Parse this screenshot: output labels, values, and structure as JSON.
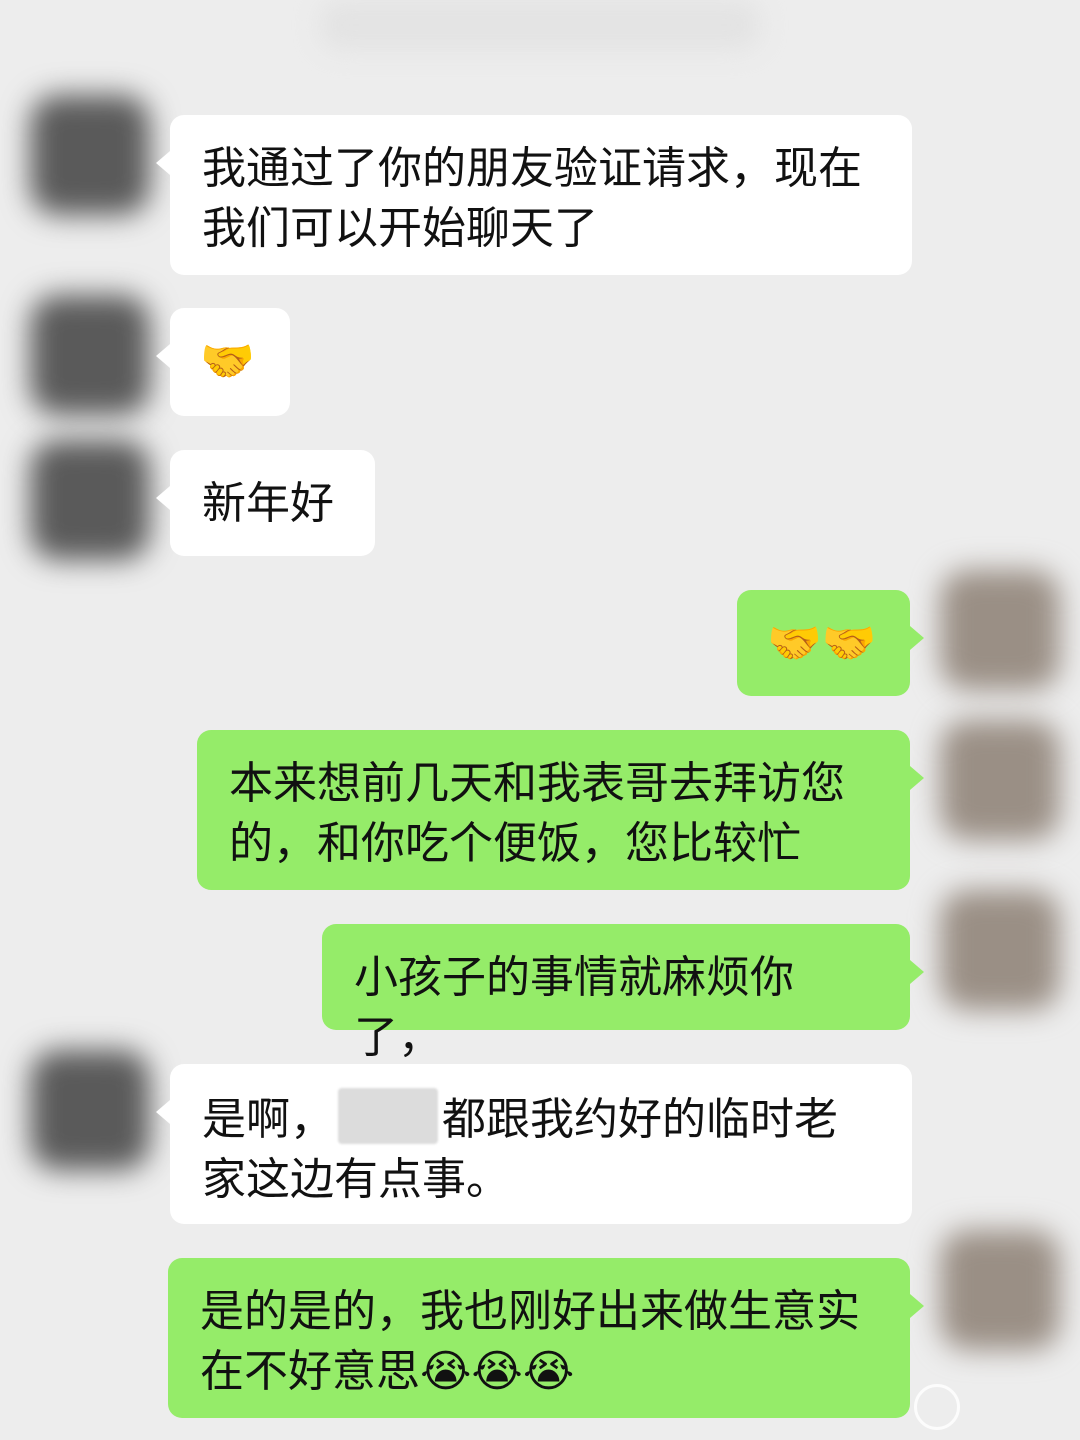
{
  "messages": [
    {
      "side": "in",
      "text": "我通过了你的朋友验证请求，现在我们可以开始聊天了"
    },
    {
      "side": "in",
      "emoji": "🤝",
      "emoji_name": "handshake"
    },
    {
      "side": "in",
      "text": "新年好"
    },
    {
      "side": "out",
      "emoji": "🤝🤝",
      "emoji_name": "handshake"
    },
    {
      "side": "out",
      "text": "本来想前几天和我表哥去拜访您的，和你吃个便饭，您比较忙"
    },
    {
      "side": "out",
      "text": "小孩子的事情就麻烦你了，"
    },
    {
      "side": "in",
      "text_before": "是啊，",
      "text_after": "都跟我约好的临时老家这边有点事。"
    },
    {
      "side": "out",
      "text": "是的是的，我也刚好出来做生意实在不好意思",
      "emoji": "😭😭😭",
      "emoji_name": "crying-laughing"
    }
  ],
  "colors": {
    "background": "#ededed",
    "incoming": "#ffffff",
    "outgoing": "#95ec69"
  }
}
